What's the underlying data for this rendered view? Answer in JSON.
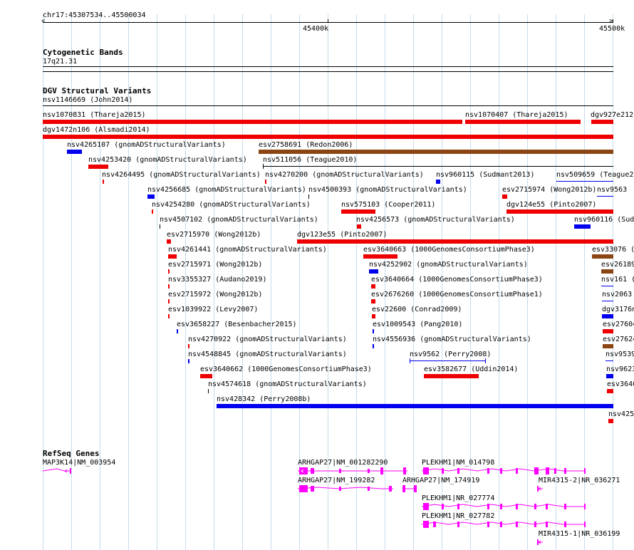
{
  "ruler": {
    "position_label": "chr17:45307534..45500034",
    "ticks": [
      "45400k",
      "45500k"
    ]
  },
  "tracks": {
    "cytoband": {
      "title": "Cytogenetic Bands",
      "band_label": "17q21.31"
    },
    "dgv": {
      "title": "DGV Structural Variants"
    },
    "refseq": {
      "title": "RefSeq Genes"
    }
  },
  "colors": {
    "red": "#ee0000",
    "blue": "#0000ee",
    "brown": "#8b4513",
    "magenta": "#ff00ff",
    "grid": "#c4dcea"
  },
  "dgv_items": [
    {
      "label": "nsv1146669 (John2014)",
      "color": "black"
    },
    {
      "label": "nsv1070831 (Thareja2015)",
      "color": "red"
    },
    {
      "label": "nsv1070407 (Thareja2015)",
      "color": "red"
    },
    {
      "label": "dgv927e212",
      "color": "red"
    },
    {
      "label": "dgv1472n106 (Alsmadi2014)",
      "color": "red"
    },
    {
      "label": "nsv4265107 (gnomADStructuralVariants)",
      "color": "blue"
    },
    {
      "label": "esv2758691 (Redon2006)",
      "color": "brown"
    },
    {
      "label": "nsv4253420 (gnomADStructuralVariants)",
      "color": "red"
    },
    {
      "label": "nsv511056 (Teague2010)",
      "color": "black"
    },
    {
      "label": "nsv4264495 (gnomADStructuralVariants)",
      "color": "red"
    },
    {
      "label": "nsv4270200 (gnomADStructuralVariants)",
      "color": "red"
    },
    {
      "label": "nsv960115 (Sudmant2013)",
      "color": "blue"
    },
    {
      "label": "nsv509659 (Teague2",
      "color": "blue"
    },
    {
      "label": "nsv4256685 (gnomADStructuralVariants)",
      "color": "blue"
    },
    {
      "label": "nsv4500393 (gnomADStructuralVariants)",
      "color": "black"
    },
    {
      "label": "esv2715974 (Wong2012b)",
      "color": "red"
    },
    {
      "label": "nsv9563",
      "color": "blue"
    },
    {
      "label": "nsv4254280 (gnomADStructuralVariants)",
      "color": "red"
    },
    {
      "label": "nsv575103 (Cooper2011)",
      "color": "red"
    },
    {
      "label": "dgv124e55 (Pinto2007)",
      "color": "red"
    },
    {
      "label": "nsv4507102 (gnomADStructuralVariants)",
      "color": "black"
    },
    {
      "label": "nsv4256573 (gnomADStructuralVariants)",
      "color": "red"
    },
    {
      "label": "nsv960116 (Sud",
      "color": "blue"
    },
    {
      "label": "esv2715970 (Wong2012b)",
      "color": "red"
    },
    {
      "label": "dgv123e55 (Pinto2007)",
      "color": "red"
    },
    {
      "label": "nsv4261441 (gnomADStructuralVariants)",
      "color": "red"
    },
    {
      "label": "esv3640663 (1000GenomesConsortiumPhase3)",
      "color": "red"
    },
    {
      "label": "esv33076 (",
      "color": "brown"
    },
    {
      "label": "esv2715971 (Wong2012b)",
      "color": "red"
    },
    {
      "label": "nsv4252902 (gnomADStructuralVariants)",
      "color": "blue"
    },
    {
      "label": "esv26189",
      "color": "brown"
    },
    {
      "label": "nsv3355327 (Audano2019)",
      "color": "red"
    },
    {
      "label": "esv3640664 (1000GenomesConsortiumPhase3)",
      "color": "red"
    },
    {
      "label": "nsv161 (",
      "color": "blue"
    },
    {
      "label": "esv2715972 (Wong2012b)",
      "color": "red"
    },
    {
      "label": "esv2676260 (1000GenomesConsortiumPhase1)",
      "color": "red"
    },
    {
      "label": "nsv2063",
      "color": "blue"
    },
    {
      "label": "esv1039922 (Levy2007)",
      "color": "red"
    },
    {
      "label": "esv22600 (Conrad2009)",
      "color": "red"
    },
    {
      "label": "dgv3176n",
      "color": "blue"
    },
    {
      "label": "esv3658227 (Besenbacher2015)",
      "color": "blue"
    },
    {
      "label": "esv1009543 (Pang2010)",
      "color": "blue"
    },
    {
      "label": "esv27604",
      "color": "red"
    },
    {
      "label": "nsv4270922 (gnomADStructuralVariants)",
      "color": "red"
    },
    {
      "label": "nsv4556936 (gnomADStructuralVariants)",
      "color": "blue"
    },
    {
      "label": "esv27624",
      "color": "brown"
    },
    {
      "label": "nsv4548845 (gnomADStructuralVariants)",
      "color": "blue"
    },
    {
      "label": "nsv9562 (Perry2008)",
      "color": "blue"
    },
    {
      "label": "nsv9539",
      "color": "blue"
    },
    {
      "label": "esv3640662 (1000GenomesConsortiumPhase3)",
      "color": "red"
    },
    {
      "label": "esv3582677 (Uddin2014)",
      "color": "red"
    },
    {
      "label": "nsv9623",
      "color": "blue"
    },
    {
      "label": "nsv4574618 (gnomADStructuralVariants)",
      "color": "black"
    },
    {
      "label": "esv3640",
      "color": "red"
    },
    {
      "label": "nsv428342 (Perry2008b)",
      "color": "blue"
    },
    {
      "label": "nsv425",
      "color": "red"
    }
  ],
  "genes": [
    {
      "label": "MAP3K14|NM_003954"
    },
    {
      "label": "ARHGAP27|NM_001282290"
    },
    {
      "label": "PLEKHM1|NM_014798"
    },
    {
      "label": "ARHGAP27|NM_199282"
    },
    {
      "label": "ARHGAP27|NM_174919"
    },
    {
      "label": "MIR4315-2|NR_036271"
    },
    {
      "label": "PLEKHM1|NR_027774"
    },
    {
      "label": "PLEKHM1|NR_027782"
    },
    {
      "label": "MIR4315-1|NR_036199"
    }
  ]
}
